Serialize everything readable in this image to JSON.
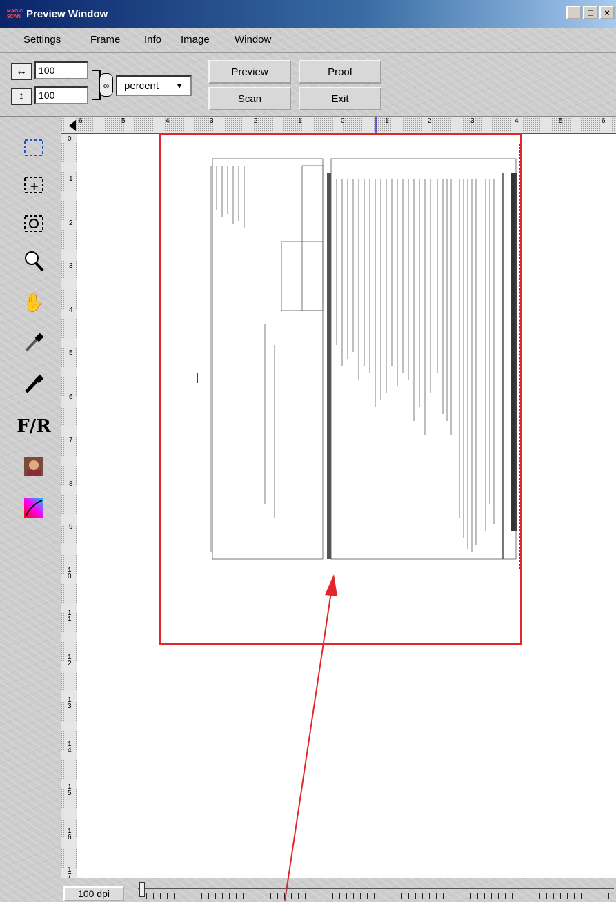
{
  "window": {
    "logo_text": "MAGIC SCAN",
    "title": "Preview Window",
    "controls": [
      "_",
      "□",
      "×"
    ]
  },
  "menu": {
    "items": [
      "Settings",
      "Frame",
      "Info",
      "Image",
      "Window"
    ]
  },
  "toolbar": {
    "width_value": "100",
    "height_value": "100",
    "unit": "percent",
    "buttons": {
      "preview": "Preview",
      "proof": "Proof",
      "scan": "Scan",
      "exit": "Exit"
    }
  },
  "tools": [
    "marquee-select-icon",
    "add-frame-icon",
    "rotate-frame-icon",
    "zoom-icon",
    "hand-icon",
    "white-eyedropper-icon",
    "black-eyedropper-icon",
    "fr-icon",
    "image-adjust-icon",
    "curve-icon"
  ],
  "ruler": {
    "horizontal_labels": [
      "6",
      "5",
      "4",
      "3",
      "2",
      "1",
      "0",
      "1",
      "2",
      "3",
      "4",
      "5",
      "6"
    ],
    "vertical_labels": [
      "0",
      "1",
      "2",
      "3",
      "4",
      "5",
      "6",
      "7",
      "8",
      "9",
      "10",
      "11",
      "12",
      "13",
      "14",
      "15",
      "16",
      "17"
    ]
  },
  "status": {
    "dpi": "100 dpi"
  },
  "colors": {
    "selection_frame": "#e3262a",
    "document_frame": "#3b3bd0",
    "annotation_arrow": "#e3262a"
  }
}
